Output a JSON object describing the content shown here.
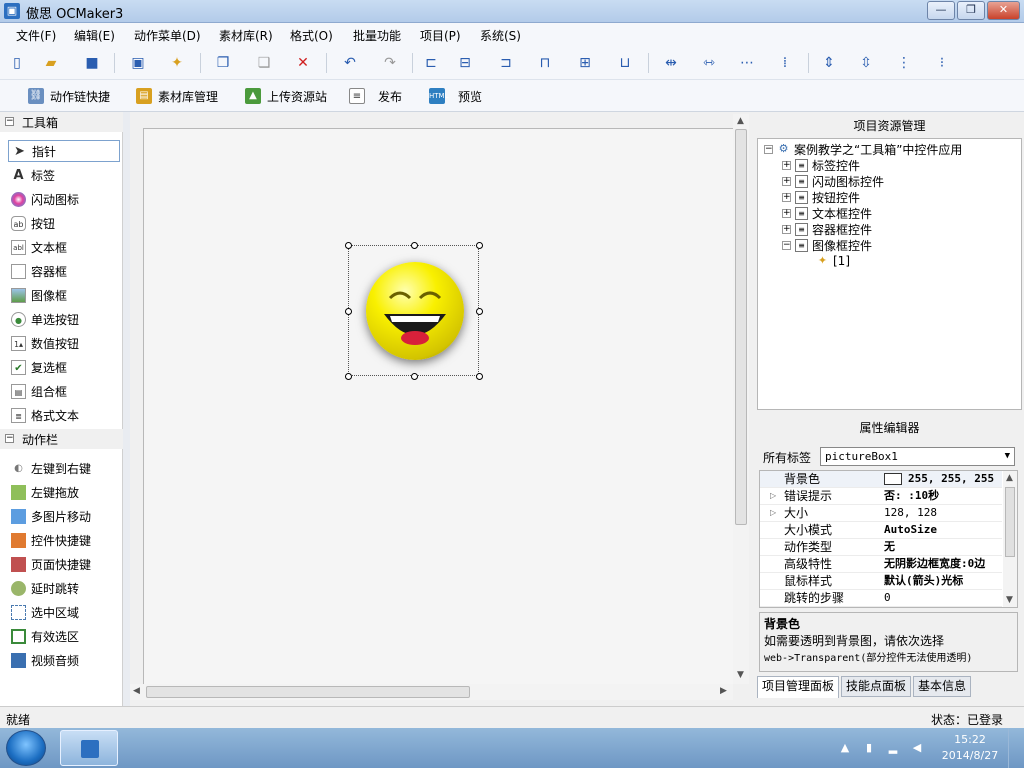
{
  "app": {
    "title": "傲思 OCMaker3",
    "icon_glyph": "▣"
  },
  "window_controls": {
    "minimize": "—",
    "maximize": "❐",
    "close": "✕"
  },
  "menu": [
    "文件(F)",
    "编辑(E)",
    "动作菜单(D)",
    "素材库(R)",
    "格式(O)",
    "批量功能",
    "项目(P)",
    "系统(S)"
  ],
  "toolbar2": {
    "chain": "动作链快捷",
    "material": "素材库管理",
    "upload": "上传资源站",
    "publish": "发布",
    "preview": "预览"
  },
  "toolbox": {
    "header": "工具箱",
    "items": [
      "指针",
      "标签",
      "闪动图标",
      "按钮",
      "文本框",
      "容器框",
      "图像框",
      "单选按钮",
      "数值按钮",
      "复选框",
      "组合框",
      "格式文本"
    ],
    "actions_header": "动作栏",
    "actions": [
      "左键到右键",
      "左键拖放",
      "多图片移动",
      "控件快捷键",
      "页面快捷键",
      "延时跳转",
      "选中区域",
      "有效选区",
      "视频音频"
    ]
  },
  "resource_panel": {
    "title": "项目资源管理",
    "root": "案例教学之“工具箱”中控件应用",
    "nodes": [
      "标签控件",
      "闪动图标控件",
      "按钮控件",
      "文本框控件",
      "容器框控件",
      "图像框控件"
    ],
    "leaf": "[1]"
  },
  "property_panel": {
    "title": "属性编辑器",
    "filter_label": "所有标签",
    "selected_object": "pictureBox1",
    "rows": [
      {
        "key": "背景色",
        "value": "255, 255, 255"
      },
      {
        "key": "错误提示",
        "value": "否: :10秒"
      },
      {
        "key": "大小",
        "value": "128, 128"
      },
      {
        "key": "大小模式",
        "value": "AutoSize"
      },
      {
        "key": "动作类型",
        "value": "无"
      },
      {
        "key": "高级特性",
        "value": "无阴影边框宽度:0边"
      },
      {
        "key": "鼠标样式",
        "value": "默认(箭头)光标"
      },
      {
        "key": "跳转的步骤",
        "value": "0"
      }
    ],
    "desc_title": "背景色",
    "desc_text": "如需要透明到背景图，请依次选择",
    "desc_text2": "web->Transparent(部分控件无法使用透明)"
  },
  "tabs": [
    "项目管理面板",
    "技能点面板",
    "基本信息"
  ],
  "status": {
    "left": "就绪",
    "right": "状态：已登录"
  },
  "taskbar": {
    "time": "15:22",
    "date": "2014/8/27"
  },
  "colors": {
    "titlebar": "#c9dcf2",
    "selection": "#7da2ce",
    "close_button": "#c9422b"
  }
}
